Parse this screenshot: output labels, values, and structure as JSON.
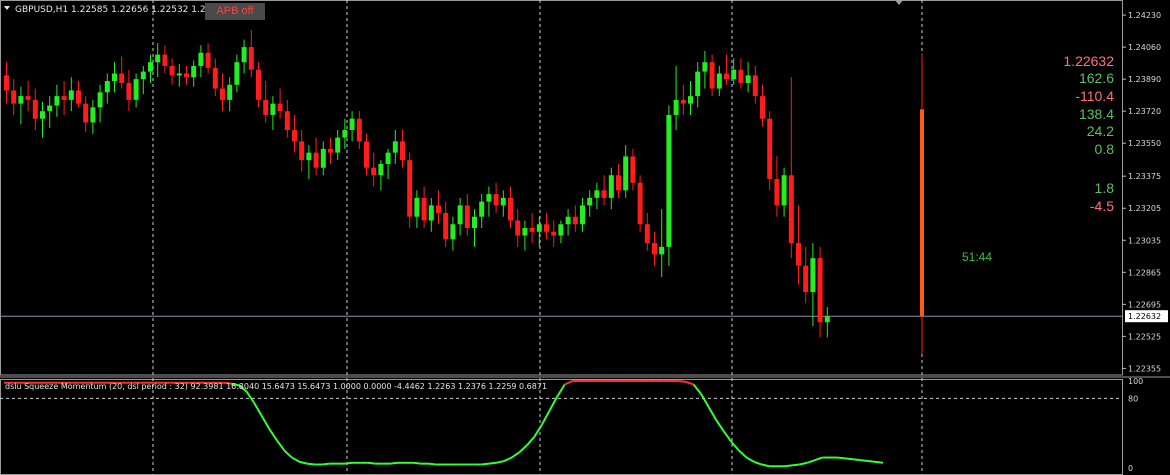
{
  "header": {
    "symbol_line": "GBPUSD,H1  1.22585 1.22656 1.22532 1.22"
  },
  "apb_button": {
    "label": "APB off"
  },
  "price_axis": {
    "ticks": [
      "1.24230",
      "1.24060",
      "1.23890",
      "1.23720",
      "1.23550",
      "1.23375",
      "1.23205",
      "1.23035",
      "1.22865",
      "1.22695",
      "1.22525",
      "1.22355"
    ],
    "current_price_label": "1.22632"
  },
  "stats": {
    "values": [
      {
        "text": "1.22632",
        "color": "#ff6f7f"
      },
      {
        "text": "162.6",
        "color": "#5fbf5f"
      },
      {
        "text": "-110.4",
        "color": "#ff6f7f"
      },
      {
        "text": "138.4",
        "color": "#5fbf5f"
      },
      {
        "text": "24.2",
        "color": "#5fbf5f"
      },
      {
        "text": "0.8",
        "color": "#5fbf5f"
      },
      {
        "text": "1.8",
        "color": "#5fbf5f"
      },
      {
        "text": "-4.5",
        "color": "#ff6f7f"
      }
    ],
    "timer": "51:44"
  },
  "indicator": {
    "title": "dslu Squeeze Momentum (20, dsl period : 32) 92.3981 16.8040 15.6473 15.6473 1.0000 0.0000 -4.4462 1.2263 1.2376 1.2259 0.6871",
    "ticks": [
      "100",
      "80",
      "0"
    ]
  },
  "colors": {
    "bull": "#22ee22",
    "bear": "#ff1c1c",
    "accent": "#ff5a1a",
    "grid": "#d0d0d0"
  },
  "chart_data": {
    "type": "candlestick",
    "symbol": "GBPUSD",
    "timeframe": "H1",
    "ylim": [
      1.2232,
      1.2431
    ],
    "current_price": 1.22632,
    "candles": [
      [
        1.2391,
        1.2398,
        1.2376,
        1.2383
      ],
      [
        1.2383,
        1.2389,
        1.237,
        1.2376
      ],
      [
        1.2376,
        1.2385,
        1.2365,
        1.238
      ],
      [
        1.238,
        1.2388,
        1.2372,
        1.2378
      ],
      [
        1.2378,
        1.2384,
        1.2362,
        1.2368
      ],
      [
        1.2368,
        1.2377,
        1.2358,
        1.2372
      ],
      [
        1.2372,
        1.238,
        1.2363,
        1.2375
      ],
      [
        1.2375,
        1.2386,
        1.2369,
        1.238
      ],
      [
        1.238,
        1.2388,
        1.237,
        1.2378
      ],
      [
        1.2378,
        1.239,
        1.2372,
        1.2383
      ],
      [
        1.2383,
        1.2388,
        1.2374,
        1.2376
      ],
      [
        1.2376,
        1.238,
        1.2361,
        1.2366
      ],
      [
        1.2366,
        1.2378,
        1.236,
        1.2374
      ],
      [
        1.2374,
        1.2386,
        1.2366,
        1.2382
      ],
      [
        1.2382,
        1.2392,
        1.2376,
        1.2388
      ],
      [
        1.2388,
        1.2398,
        1.2382,
        1.2392
      ],
      [
        1.2392,
        1.2401,
        1.2384,
        1.2387
      ],
      [
        1.2387,
        1.2394,
        1.2372,
        1.2378
      ],
      [
        1.2378,
        1.2392,
        1.2374,
        1.2389
      ],
      [
        1.2389,
        1.2396,
        1.2381,
        1.2393
      ],
      [
        1.2393,
        1.2402,
        1.2387,
        1.2398
      ],
      [
        1.2398,
        1.2408,
        1.239,
        1.2402
      ],
      [
        1.2402,
        1.2407,
        1.2392,
        1.2396
      ],
      [
        1.2396,
        1.24,
        1.2386,
        1.2391
      ],
      [
        1.2391,
        1.2397,
        1.2385,
        1.2392
      ],
      [
        1.2392,
        1.2396,
        1.2386,
        1.239
      ],
      [
        1.239,
        1.2399,
        1.2385,
        1.2396
      ],
      [
        1.2396,
        1.2407,
        1.239,
        1.2403
      ],
      [
        1.2403,
        1.2408,
        1.2392,
        1.2395
      ],
      [
        1.2395,
        1.24,
        1.238,
        1.2384
      ],
      [
        1.2384,
        1.2392,
        1.2372,
        1.2378
      ],
      [
        1.2378,
        1.239,
        1.2372,
        1.2386
      ],
      [
        1.2386,
        1.2402,
        1.2382,
        1.2398
      ],
      [
        1.2398,
        1.241,
        1.2392,
        1.2406
      ],
      [
        1.2406,
        1.2415,
        1.239,
        1.2394
      ],
      [
        1.2394,
        1.2398,
        1.2374,
        1.2378
      ],
      [
        1.2378,
        1.2388,
        1.2366,
        1.237
      ],
      [
        1.237,
        1.238,
        1.2362,
        1.2376
      ],
      [
        1.2376,
        1.2384,
        1.2368,
        1.2372
      ],
      [
        1.2372,
        1.2378,
        1.2358,
        1.2362
      ],
      [
        1.2362,
        1.237,
        1.235,
        1.2356
      ],
      [
        1.2356,
        1.2362,
        1.234,
        1.2346
      ],
      [
        1.2346,
        1.2354,
        1.2336,
        1.235
      ],
      [
        1.235,
        1.2358,
        1.2338,
        1.2342
      ],
      [
        1.2342,
        1.2356,
        1.2338,
        1.2352
      ],
      [
        1.2352,
        1.2358,
        1.2344,
        1.235
      ],
      [
        1.235,
        1.2362,
        1.2346,
        1.2358
      ],
      [
        1.2358,
        1.2368,
        1.2352,
        1.2362
      ],
      [
        1.2362,
        1.2372,
        1.2356,
        1.2368
      ],
      [
        1.2368,
        1.2372,
        1.2352,
        1.2356
      ],
      [
        1.2356,
        1.236,
        1.2338,
        1.2342
      ],
      [
        1.2342,
        1.235,
        1.2332,
        1.2338
      ],
      [
        1.2338,
        1.2346,
        1.233,
        1.2344
      ],
      [
        1.2344,
        1.2352,
        1.2336,
        1.235
      ],
      [
        1.235,
        1.2362,
        1.2344,
        1.2356
      ],
      [
        1.2356,
        1.2362,
        1.2342,
        1.2346
      ],
      [
        1.2346,
        1.235,
        1.231,
        1.2316
      ],
      [
        1.2316,
        1.233,
        1.231,
        1.2326
      ],
      [
        1.2326,
        1.2332,
        1.231,
        1.2314
      ],
      [
        1.2314,
        1.2326,
        1.2308,
        1.2322
      ],
      [
        1.2322,
        1.233,
        1.2312,
        1.2318
      ],
      [
        1.2318,
        1.2324,
        1.23,
        1.2304
      ],
      [
        1.2304,
        1.2316,
        1.2298,
        1.2312
      ],
      [
        1.2312,
        1.2326,
        1.2306,
        1.2322
      ],
      [
        1.2322,
        1.2328,
        1.2306,
        1.231
      ],
      [
        1.231,
        1.232,
        1.23,
        1.2316
      ],
      [
        1.2316,
        1.2328,
        1.231,
        1.2324
      ],
      [
        1.2324,
        1.2332,
        1.2316,
        1.2328
      ],
      [
        1.2328,
        1.2334,
        1.2318,
        1.2322
      ],
      [
        1.2322,
        1.233,
        1.2316,
        1.2326
      ],
      [
        1.2326,
        1.2332,
        1.231,
        1.2314
      ],
      [
        1.2314,
        1.232,
        1.23,
        1.2306
      ],
      [
        1.2306,
        1.2314,
        1.2298,
        1.231
      ],
      [
        1.231,
        1.2318,
        1.2302,
        1.2308
      ],
      [
        1.2308,
        1.2316,
        1.23,
        1.2312
      ],
      [
        1.2312,
        1.2318,
        1.2304,
        1.2308
      ],
      [
        1.2308,
        1.2314,
        1.23,
        1.2306
      ],
      [
        1.2306,
        1.2314,
        1.2302,
        1.2312
      ],
      [
        1.2312,
        1.232,
        1.2306,
        1.2316
      ],
      [
        1.2316,
        1.2322,
        1.2308,
        1.2312
      ],
      [
        1.2312,
        1.2326,
        1.2308,
        1.2322
      ],
      [
        1.2322,
        1.233,
        1.2316,
        1.2326
      ],
      [
        1.2326,
        1.2334,
        1.232,
        1.233
      ],
      [
        1.233,
        1.2338,
        1.2322,
        1.2326
      ],
      [
        1.2326,
        1.2342,
        1.232,
        1.2338
      ],
      [
        1.2338,
        1.2344,
        1.2326,
        1.233
      ],
      [
        1.233,
        1.2354,
        1.2326,
        1.2348
      ],
      [
        1.2348,
        1.2352,
        1.233,
        1.2334
      ],
      [
        1.2334,
        1.2338,
        1.2308,
        1.2312
      ],
      [
        1.2312,
        1.2318,
        1.2298,
        1.2302
      ],
      [
        1.2302,
        1.2308,
        1.229,
        1.2296
      ],
      [
        1.2296,
        1.232,
        1.2284,
        1.23
      ],
      [
        1.23,
        1.2375,
        1.229,
        1.237
      ],
      [
        1.237,
        1.2396,
        1.2362,
        1.2378
      ],
      [
        1.2378,
        1.2386,
        1.237,
        1.2376
      ],
      [
        1.2376,
        1.2388,
        1.237,
        1.238
      ],
      [
        1.238,
        1.2398,
        1.2374,
        1.2393
      ],
      [
        1.2393,
        1.2404,
        1.2384,
        1.2398
      ],
      [
        1.2398,
        1.2402,
        1.238,
        1.2384
      ],
      [
        1.2384,
        1.2396,
        1.238,
        1.2392
      ],
      [
        1.2392,
        1.2402,
        1.2386,
        1.2389
      ],
      [
        1.2389,
        1.24,
        1.2386,
        1.2394
      ],
      [
        1.2394,
        1.24,
        1.2384,
        1.2387
      ],
      [
        1.2387,
        1.2398,
        1.2382,
        1.2391
      ],
      [
        1.2391,
        1.2396,
        1.2376,
        1.238
      ],
      [
        1.238,
        1.2386,
        1.2364,
        1.2368
      ],
      [
        1.2368,
        1.2372,
        1.233,
        1.2336
      ],
      [
        1.2336,
        1.2348,
        1.2316,
        1.2322
      ],
      [
        1.2322,
        1.2342,
        1.2316,
        1.2338
      ],
      [
        1.2338,
        1.239,
        1.2294,
        1.2302
      ],
      [
        1.2302,
        1.2322,
        1.228,
        1.229
      ],
      [
        1.229,
        1.23,
        1.227,
        1.2276
      ],
      [
        1.2276,
        1.2302,
        1.2258,
        1.2294
      ],
      [
        1.2294,
        1.23,
        1.2252,
        1.226
      ],
      [
        1.226,
        1.2268,
        1.2252,
        1.2263
      ]
    ],
    "spike_candle": [
      1.2373,
      1.2402,
      1.2243,
      1.2263
    ],
    "indicator_series": [
      98,
      98,
      98,
      98,
      98,
      98,
      98,
      98,
      98,
      98,
      98,
      98,
      98,
      98,
      98,
      98,
      98,
      98,
      98,
      98,
      98,
      98,
      98,
      98,
      98,
      98,
      98,
      98,
      98,
      98,
      97,
      95,
      88,
      75,
      60,
      45,
      32,
      20,
      12,
      7,
      5,
      4,
      4,
      5,
      5,
      5,
      6,
      6,
      6,
      5,
      5,
      5,
      6,
      6,
      6,
      5,
      5,
      4,
      4,
      4,
      4,
      4,
      4,
      4,
      5,
      6,
      8,
      12,
      18,
      26,
      36,
      50,
      66,
      82,
      96,
      100,
      100,
      100,
      100,
      100,
      100,
      100,
      100,
      100,
      100,
      100,
      100,
      100,
      100,
      100,
      99,
      96,
      85,
      70,
      55,
      42,
      30,
      20,
      12,
      7,
      4,
      2,
      2,
      2,
      3,
      4,
      6,
      9,
      12,
      12,
      12,
      11,
      10,
      9,
      8,
      7,
      6
    ],
    "indicator_ylim": [
      0,
      100
    ]
  }
}
